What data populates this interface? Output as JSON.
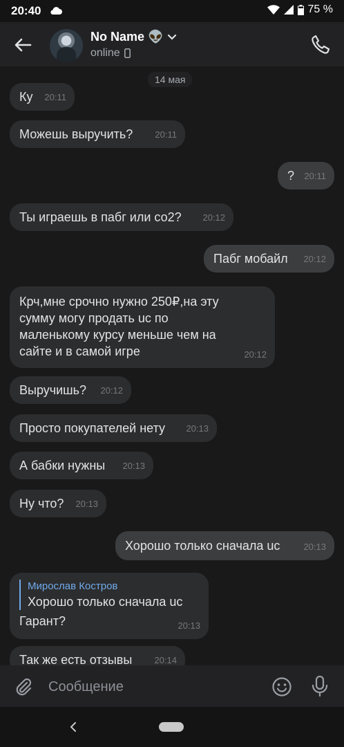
{
  "status_bar": {
    "time": "20:40",
    "battery": "75 %",
    "icons": [
      "cloud-icon",
      "wifi-icon",
      "signal-icon",
      "battery-icon"
    ]
  },
  "header": {
    "name": "No Name 👽",
    "status": "online",
    "icons": [
      "back-arrow-icon",
      "chevron-down-icon",
      "mobile-icon",
      "phone-icon"
    ]
  },
  "date_separator": "14 мая",
  "messages": [
    {
      "dir": "in",
      "text": "Ку",
      "time": "20:11"
    },
    {
      "dir": "in",
      "text": "Можешь выручить?",
      "time": "20:11"
    },
    {
      "dir": "out",
      "text": "?",
      "time": "20:11"
    },
    {
      "dir": "in",
      "text": "Ты играешь в пабг или со2?",
      "time": "20:12"
    },
    {
      "dir": "out",
      "text": "Пабг мобайл",
      "time": "20:12"
    },
    {
      "dir": "in",
      "text": "Крч,мне срочно нужно 250₽,на эту сумму могу продать uc по маленькому курсу меньше чем на сайте и в самой игре",
      "time": "20:12"
    },
    {
      "dir": "in",
      "text": "Выручишь?",
      "time": "20:12"
    },
    {
      "dir": "in",
      "text": "Просто покупателей нету",
      "time": "20:13"
    },
    {
      "dir": "in",
      "text": "А бабки нужны",
      "time": "20:13"
    },
    {
      "dir": "in",
      "text": "Ну что?",
      "time": "20:13"
    },
    {
      "dir": "out",
      "text": "Хорошо только сначала uc",
      "time": "20:13"
    },
    {
      "dir": "in",
      "reply_name": "Мирослав Костров",
      "reply_text": "Хорошо только сначала uc",
      "text": "Гарант?",
      "time": "20:13"
    },
    {
      "dir": "in",
      "text": "Так же есть отзывы",
      "time": "20:14"
    }
  ],
  "composer": {
    "placeholder": "Сообщение",
    "icons": [
      "paperclip-icon",
      "emoji-icon",
      "microphone-icon"
    ]
  },
  "colors": {
    "background": "#19191a",
    "bubble_in": "#2c2d2e",
    "bubble_out": "#3c3d3f",
    "accent": "#71aaeb"
  }
}
